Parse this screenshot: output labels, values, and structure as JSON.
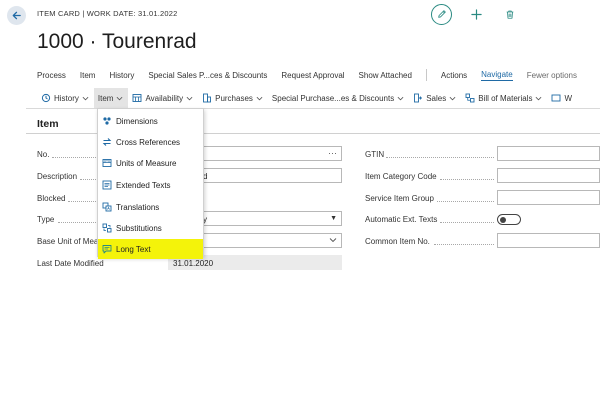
{
  "header": {
    "context": "ITEM CARD | WORK DATE: 31.01.2022",
    "title": "1000 · Tourenrad"
  },
  "actionbar": {
    "items": [
      "Process",
      "Item",
      "History",
      "Special Sales P...ces & Discounts",
      "Request Approval",
      "Show Attached"
    ],
    "actions": "Actions",
    "navigate": "Navigate",
    "fewer_options": "Fewer options"
  },
  "ribbon": {
    "items": [
      {
        "label": "History",
        "icon": "history-icon"
      },
      {
        "label": "Item",
        "icon": "none"
      },
      {
        "label": "Availability",
        "icon": "availability-icon"
      },
      {
        "label": "Purchases",
        "icon": "purchases-icon"
      },
      {
        "label": "Special Purchase...es & Discounts",
        "icon": "none"
      },
      {
        "label": "Sales",
        "icon": "sales-icon"
      },
      {
        "label": "Bill of Materials",
        "icon": "bom-icon"
      },
      {
        "label": "W",
        "icon": "more-icon"
      }
    ]
  },
  "section": {
    "title": "Item"
  },
  "left_fields": [
    {
      "label": "No.",
      "value": "",
      "trailing": "···"
    },
    {
      "label": "Description",
      "value": "d"
    },
    {
      "label": "Blocked",
      "value": ""
    },
    {
      "label": "Type",
      "value": "y"
    },
    {
      "label": "Base Unit of Meas",
      "value": ""
    },
    {
      "label": "Last Date Modified",
      "value": "31.01.2020"
    }
  ],
  "right_fields": [
    {
      "label": "GTIN",
      "value": ""
    },
    {
      "label": "Item Category Code",
      "value": ""
    },
    {
      "label": "Service Item Group",
      "value": ""
    },
    {
      "label": "Automatic Ext. Texts",
      "value": ""
    },
    {
      "label": "Common Item No.",
      "value": ""
    }
  ],
  "dropdown": {
    "items": [
      {
        "label": "Dimensions",
        "icon": "dimensions-icon",
        "highlighted": false
      },
      {
        "label": "Cross References",
        "icon": "cross-references-icon",
        "highlighted": false
      },
      {
        "label": "Units of Measure",
        "icon": "units-of-measure-icon",
        "highlighted": false
      },
      {
        "label": "Extended Texts",
        "icon": "extended-texts-icon",
        "highlighted": false
      },
      {
        "label": "Translations",
        "icon": "translations-icon",
        "highlighted": false
      },
      {
        "label": "Substitutions",
        "icon": "substitutions-icon",
        "highlighted": false
      },
      {
        "label": "Long Text",
        "icon": "long-text-icon",
        "highlighted": true
      }
    ]
  },
  "colors": {
    "accent": "#1f6aa5",
    "teal": "#2a8a82",
    "highlight": "#f4f30a"
  }
}
